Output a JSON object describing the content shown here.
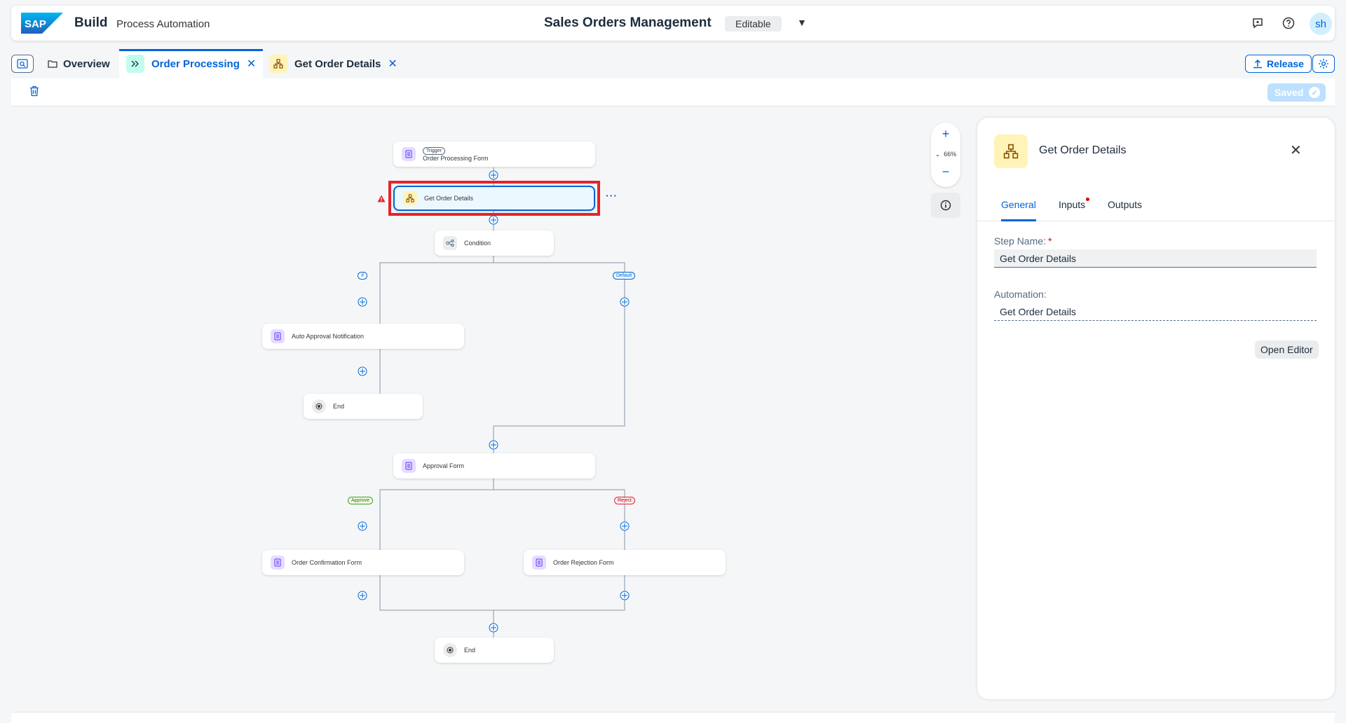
{
  "shell": {
    "brand_logo": "SAP",
    "brand": "Build",
    "product": "Process Automation",
    "project_title": "Sales Orders Management",
    "status_badge": "Editable",
    "avatar_initials": "sh"
  },
  "tabs": {
    "overview": "Overview",
    "order_processing": "Order Processing",
    "get_order_details": "Get Order Details",
    "release": "Release"
  },
  "toolbar": {
    "saved_label": "Saved"
  },
  "canvas": {
    "zoom_level": "66%",
    "nodes": {
      "trigger_pill": "Trigger",
      "trigger": "Order Processing Form",
      "get_order_details": "Get Order Details",
      "condition": "Condition",
      "auto_approval": "Auto Approval Notification",
      "end1": "End",
      "approval_form": "Approval Form",
      "order_confirmation": "Order Confirmation Form",
      "order_rejection": "Order Rejection Form",
      "end2": "End"
    },
    "branch_labels": {
      "if": "If",
      "default": "Default",
      "approve": "Approve",
      "reject": "Reject"
    }
  },
  "panel": {
    "title": "Get Order Details",
    "tabs": {
      "general": "General",
      "inputs": "Inputs",
      "outputs": "Outputs"
    },
    "step_name_label": "Step Name:",
    "step_name_value": "Get Order Details",
    "automation_label": "Automation:",
    "automation_value": "Get Order Details",
    "open_editor": "Open Editor"
  },
  "colors": {
    "accent": "#0064d9",
    "highlight": "#e5232b",
    "form_icon_bg": "#e6dcff",
    "automation_icon_bg": "#fff3b8"
  }
}
